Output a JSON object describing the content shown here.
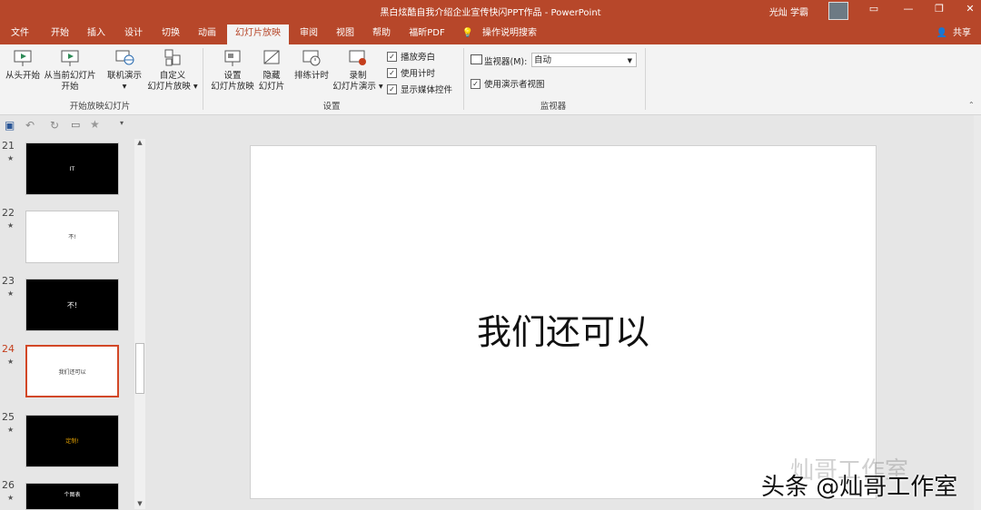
{
  "window": {
    "title": "黑白炫酷自我介绍企业宣传快闪PPT作品 - PowerPoint",
    "user": "光灿 学霸",
    "share_label": "共享"
  },
  "tabs": [
    "文件",
    "开始",
    "插入",
    "设计",
    "切换",
    "动画",
    "幻灯片放映",
    "审阅",
    "视图",
    "帮助",
    "福昕PDF",
    "操作说明搜索"
  ],
  "ribbon": {
    "start_group": {
      "from_beginning": "从头开始",
      "from_current_1": "从当前幻灯片",
      "from_current_2": "开始",
      "online_1": "联机演示",
      "online_2": "▾",
      "custom_1": "自定义",
      "custom_2": "幻灯片放映 ▾",
      "label": "开始放映幻灯片"
    },
    "setup_group": {
      "setup_1": "设置",
      "setup_2": "幻灯片放映",
      "hide_1": "隐藏",
      "hide_2": "幻灯片",
      "rehearse": "排练计时",
      "record_1": "录制",
      "record_2": "幻灯片演示 ▾",
      "play_narrations": "播放旁白",
      "use_timings": "使用计时",
      "show_media": "显示媒体控件",
      "label": "设置"
    },
    "monitor_group": {
      "monitor_label": "监视器(M):",
      "monitor_value": "自动",
      "presenter_view": "使用演示者视图",
      "label": "监视器"
    }
  },
  "thumbnails": [
    {
      "num": "21",
      "text": "IT",
      "bg": "#000000",
      "fg": "#ffffff"
    },
    {
      "num": "22",
      "text": "不!",
      "bg": "#ffffff",
      "fg": "#333333"
    },
    {
      "num": "23",
      "text": "不!",
      "bg": "#000000",
      "fg": "#ffffff"
    },
    {
      "num": "24",
      "text": "我们还可以",
      "bg": "#ffffff",
      "fg": "#333333",
      "selected": true
    },
    {
      "num": "25",
      "text": "定制!",
      "bg": "#000000",
      "fg": "#e8a400"
    },
    {
      "num": "26",
      "text": "个图表",
      "bg": "#000000",
      "fg": "#ffffff"
    }
  ],
  "slide": {
    "text": "我们还可以"
  },
  "watermark": {
    "top": "灿哥工作室",
    "bottom": "头条 @灿哥工作室"
  }
}
